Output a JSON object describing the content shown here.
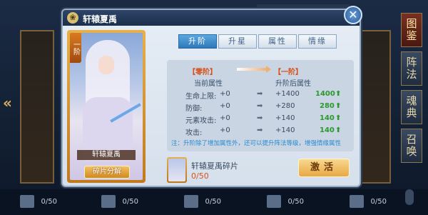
{
  "dialog": {
    "title": "轩辕夏禹",
    "close_glyph": "✕",
    "title_icon": "❀"
  },
  "portrait": {
    "rank": "一阶",
    "name": "轩辕夏禹",
    "decompose_label": "碎片分解"
  },
  "tabs": [
    {
      "label": "升阶",
      "active": true
    },
    {
      "label": "升星",
      "active": false
    },
    {
      "label": "属性",
      "active": false
    },
    {
      "label": "情缘",
      "active": false
    }
  ],
  "stages": {
    "current": "【零阶】",
    "next": "【一阶】"
  },
  "stats": {
    "current_header": "当前属性",
    "after_header": "升阶后属性",
    "rows": [
      {
        "name": "生命上限:",
        "current": "+0",
        "after": "+1400",
        "gain": "1400",
        "up": "⬆"
      },
      {
        "name": "防御:",
        "current": "+0",
        "after": "+280",
        "gain": "280",
        "up": "⬆"
      },
      {
        "name": "元素攻击:",
        "current": "+0",
        "after": "+140",
        "gain": "140",
        "up": "⬆"
      },
      {
        "name": "攻击:",
        "current": "+0",
        "after": "+140",
        "gain": "140",
        "up": "⬆"
      }
    ],
    "arrow_glyph": "➡",
    "note": "注：升阶除了增加属性外，还可以提升阵法等级，增强情缘属性"
  },
  "fragment": {
    "name": "轩辕夏禹碎片",
    "count": "0/50",
    "activate_label": "激活"
  },
  "side_nav": [
    {
      "label": "图鉴",
      "active": true
    },
    {
      "label": "阵法",
      "active": false
    },
    {
      "label": "魂典",
      "active": false
    },
    {
      "label": "召唤",
      "active": false
    }
  ],
  "bottom_counts": [
    "0/50",
    "0/50",
    "0/50",
    "0/50",
    "0/50"
  ],
  "left_arrow": "«",
  "colors": {
    "accent": "#2e78b8",
    "gain": "#2a9a2a",
    "stage": "#d85018"
  }
}
